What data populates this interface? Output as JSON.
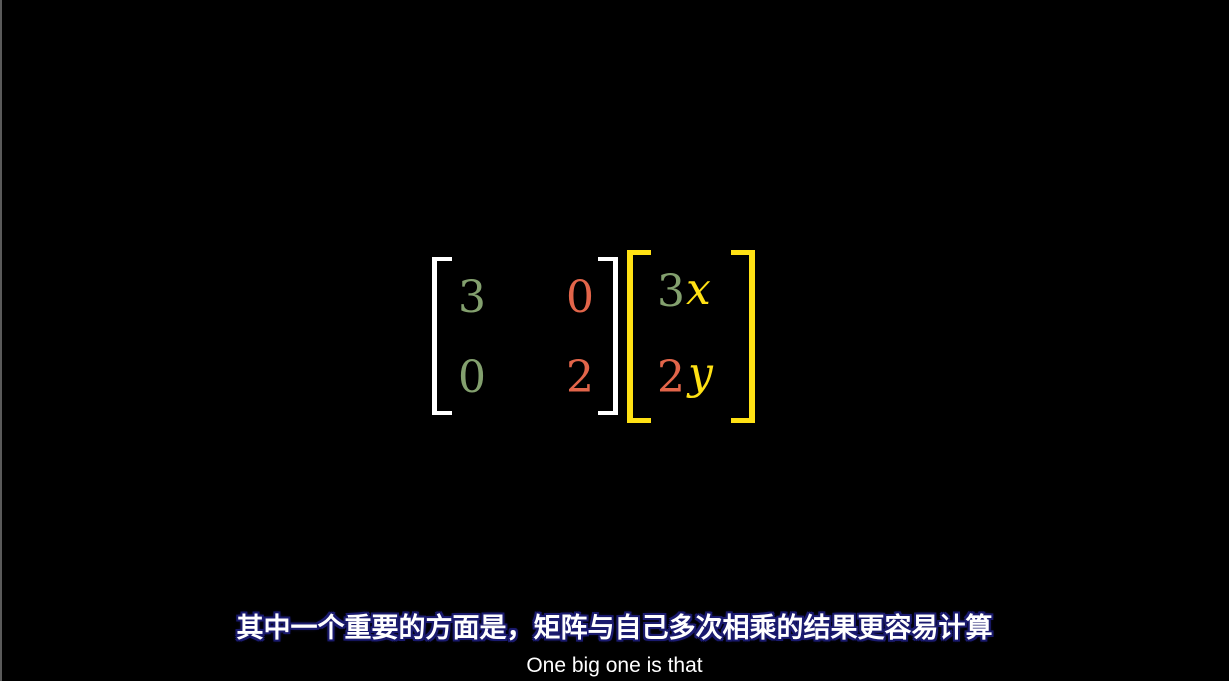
{
  "matrix": {
    "a11": "3",
    "a12": "0",
    "a21": "0",
    "a22": "2"
  },
  "vector": {
    "row1_coef": "3",
    "row1_var": "x",
    "row2_coef": "2",
    "row2_var": "y"
  },
  "subtitles": {
    "chinese": "其中一个重要的方面是，矩阵与自己多次相乘的结果更容易计算",
    "english": "One big one is that"
  },
  "colors": {
    "background": "#000000",
    "matrix_bracket": "#ffffff",
    "vector_bracket": "#ffe114",
    "column1": "#83a06e",
    "column2": "#e2654a",
    "variable": "#ffe114",
    "subtitle_outline": "#1a1a6e"
  }
}
